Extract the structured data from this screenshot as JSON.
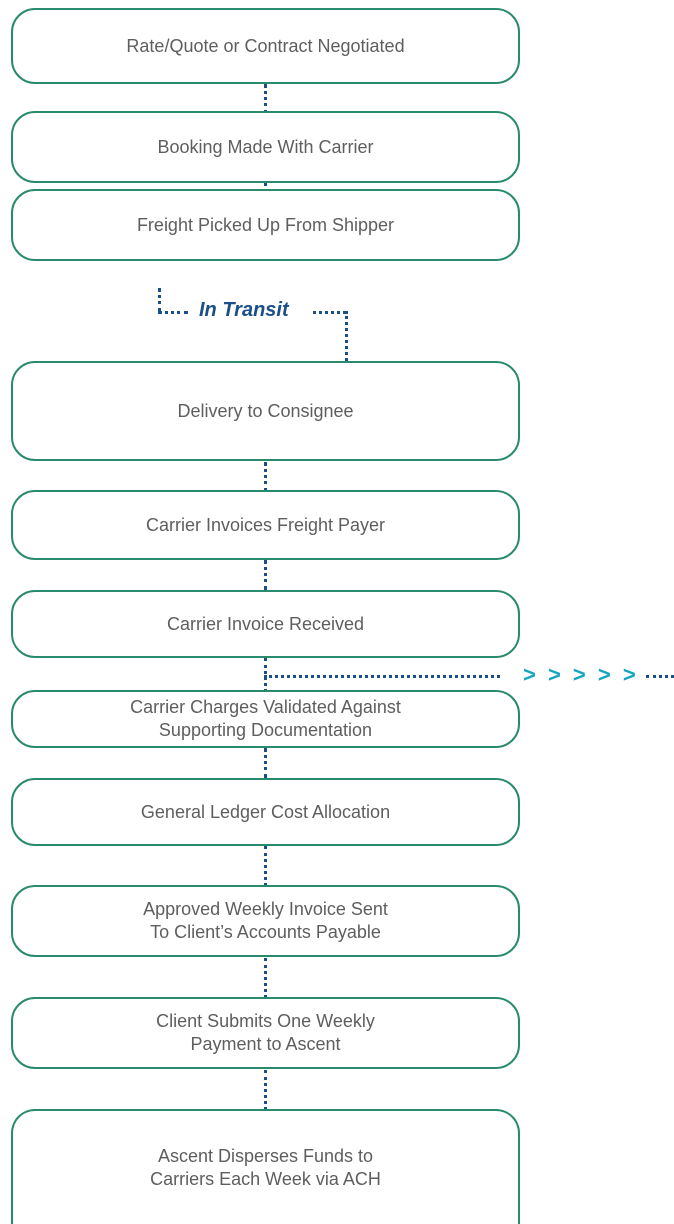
{
  "steps": [
    "Rate/Quote or Contract Negotiated",
    "Booking Made With Carrier",
    "Freight Picked Up From Shipper",
    "Delivery to Consignee",
    "Carrier Invoices Freight Payer",
    "Carrier Invoice Received",
    "Carrier Charges Validated Against\nSupporting Documentation",
    "General Ledger Cost Allocation",
    "Approved Weekly Invoice Sent\nTo Client’s Accounts Payable",
    "Client Submits One Weekly\nPayment to Ascent",
    "Ascent Disperses Funds to\nCarriers Each Week via ACH"
  ],
  "transit_label": "In Transit",
  "arrows": "> > > > >",
  "colors": {
    "box_border": "#2a8a6e",
    "box_text": "#5e5e5e",
    "connector": "#1b4f8a",
    "transit_text": "#1b4f8a",
    "arrows": "#13a6c0"
  }
}
